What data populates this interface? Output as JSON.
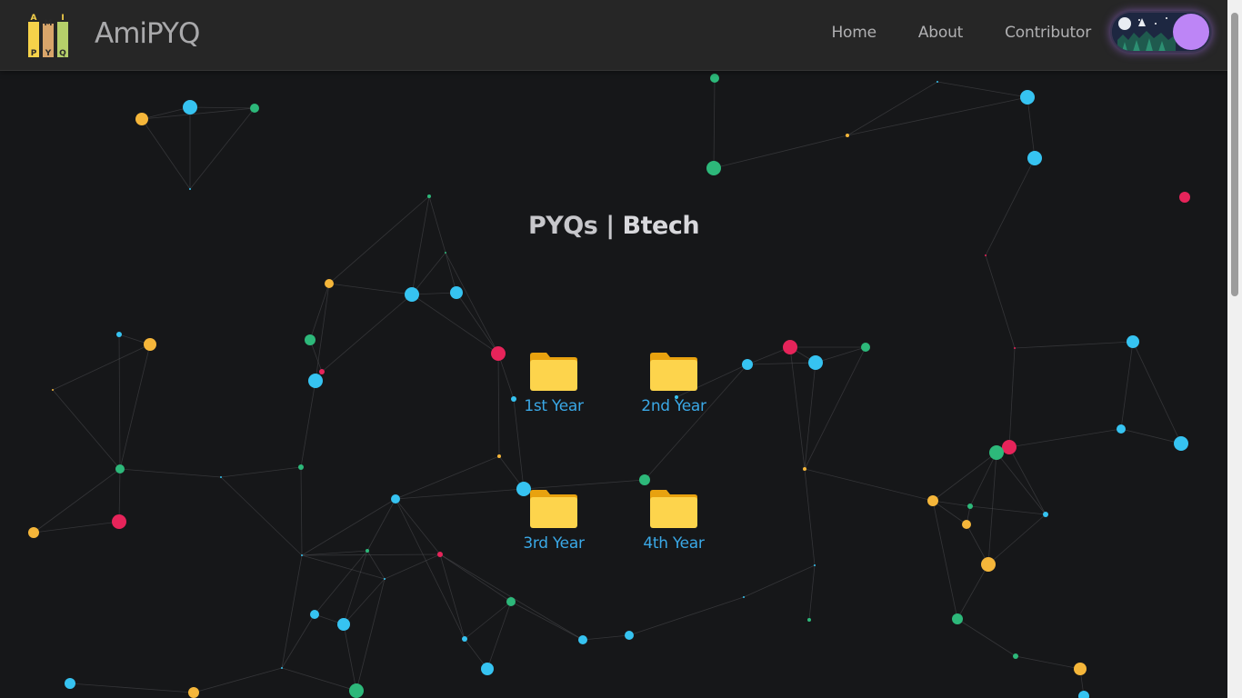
{
  "app": {
    "brand": "AmiPYQ",
    "logo_letters": [
      "A",
      "M",
      "I",
      "P",
      "Y",
      "Q"
    ]
  },
  "nav": {
    "links": [
      "Home",
      "About",
      "Contributor"
    ]
  },
  "theme_toggle": {
    "state": "dark",
    "icons": [
      "moon-icon",
      "tree-icon"
    ]
  },
  "page": {
    "title_prefix": "PYQs",
    "title_separator": "|",
    "title_bold": "Btech"
  },
  "folders": [
    {
      "label": "1st Year",
      "icon": "folder-icon"
    },
    {
      "label": "2nd Year",
      "icon": "folder-icon"
    },
    {
      "label": "3rd Year",
      "icon": "folder-icon"
    },
    {
      "label": "4th Year",
      "icon": "folder-icon"
    }
  ],
  "colors": {
    "background": "#161719",
    "navbar": "#262626",
    "brand_text": "#a9a9ab",
    "folder_label": "#3aa8e6",
    "folder_body": "#fdd44c",
    "toggle_knob": "#bd85f6",
    "node_blue": "#36c3f1",
    "node_yellow": "#f5b63a",
    "node_green": "#2db87a",
    "node_red": "#e6245a"
  }
}
